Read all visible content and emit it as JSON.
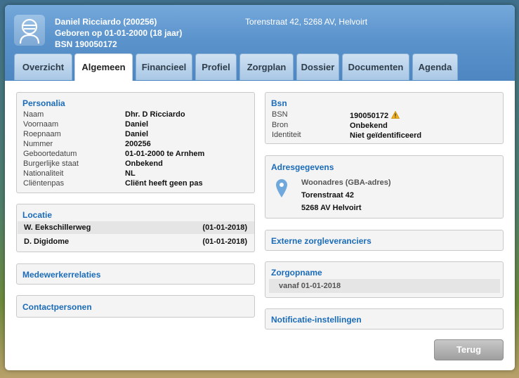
{
  "header": {
    "name_line": "Daniel Ricciardo (200256)",
    "birth_line": "Geboren op 01-01-2000 (18 jaar)",
    "bsn_line": "BSN 190050172",
    "address": "Torenstraat 42, 5268 AV, Helvoirt"
  },
  "tabs": [
    {
      "label": "Overzicht"
    },
    {
      "label": "Algemeen"
    },
    {
      "label": "Financieel"
    },
    {
      "label": "Profiel"
    },
    {
      "label": "Zorgplan"
    },
    {
      "label": "Dossier"
    },
    {
      "label": "Documenten"
    },
    {
      "label": "Agenda"
    }
  ],
  "personalia": {
    "title": "Personalia",
    "rows": [
      {
        "key": "Naam",
        "value": "Dhr. D Ricciardo"
      },
      {
        "key": "Voornaam",
        "value": "Daniel"
      },
      {
        "key": "Roepnaam",
        "value": "Daniel"
      },
      {
        "key": "Nummer",
        "value": "200256"
      },
      {
        "key": "Geboortedatum",
        "value": "01-01-2000 te Arnhem"
      },
      {
        "key": "Burgerlijke staat",
        "value": "Onbekend"
      },
      {
        "key": "Nationaliteit",
        "value": "NL"
      },
      {
        "key": "Cliëntenpas",
        "value": "Cliënt heeft geen pas"
      }
    ]
  },
  "locatie": {
    "title": "Locatie",
    "rows": [
      {
        "name": "W. Eekschillerweg",
        "date": "(01-01-2018)"
      },
      {
        "name": "D. Digidome",
        "date": "(01-01-2018)"
      }
    ]
  },
  "medewerkerrelaties": {
    "title": "Medewerkerrelaties"
  },
  "contactpersonen": {
    "title": "Contactpersonen"
  },
  "bsn": {
    "title": "Bsn",
    "rows": [
      {
        "key": "BSN",
        "value": "190050172"
      },
      {
        "key": "Bron",
        "value": "Onbekend"
      },
      {
        "key": "Identiteit",
        "value": "Niet geïdentificeerd"
      }
    ]
  },
  "adresgegevens": {
    "title": "Adresgegevens",
    "type": "Woonadres (GBA-adres)",
    "street": "Torenstraat 42",
    "city": "5268 AV Helvoirt"
  },
  "externe": {
    "title": "Externe zorgleveranciers"
  },
  "zorgopname": {
    "title": "Zorgopname",
    "value": "vanaf 01-01-2018"
  },
  "notificatie": {
    "title": "Notificatie-instellingen"
  },
  "terug_label": "Terug",
  "icons": {
    "avatar": "person-avatar-icon",
    "pin": "map-pin-icon",
    "warning": "warning-icon"
  },
  "colors": {
    "accent": "#1a6bb8",
    "header": "#5b93cc"
  }
}
